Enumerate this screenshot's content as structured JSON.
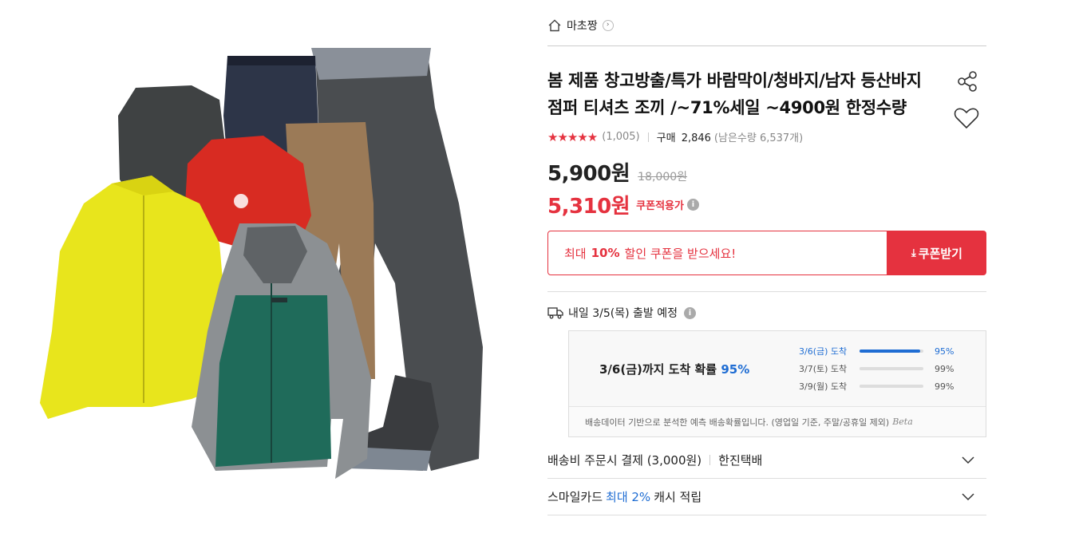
{
  "shop": {
    "name": "마초짱",
    "home_icon": "home-icon",
    "arrow": "›"
  },
  "product": {
    "title": "봄 제품 창고방출/특가 바람막이/청바지/남자 등산바지 점퍼 티셔츠 조끼 /~71%세일 ~4900원 한정수량",
    "stars": "★★★★★",
    "rating": 4.5,
    "review_count": "(1,005)",
    "purchase_label": "구매",
    "purchase_count": "2,846",
    "remaining": "(남은수량 6,537개)"
  },
  "price": {
    "sale": "5,900원",
    "original": "18,000원",
    "coupon_price": "5,310원",
    "coupon_label": "쿠폰적용가",
    "info_icon": "i"
  },
  "coupon": {
    "msg_prefix": "최대",
    "msg_strong": "10%",
    "msg_suffix": "할인 쿠폰을 받으세요!",
    "button_icon": "⤓",
    "button_label": "쿠폰받기"
  },
  "shipping": {
    "depart_text": "내일 3/5(목) 출발 예정",
    "headline_prefix": "3/6(금)까지 도착 확률",
    "headline_pct": "95%",
    "rows": [
      {
        "date": "3/6(금) 도착",
        "pct": "95%",
        "value": 0.95,
        "active": true
      },
      {
        "date": "3/7(토) 도착",
        "pct": "99%",
        "value": 0.99,
        "active": false
      },
      {
        "date": "3/9(월) 도착",
        "pct": "99%",
        "value": 0.99,
        "active": false
      }
    ],
    "note": "배송데이터 기반으로 분석한 예측 배송확률입니다. (영업일 기준, 주말/공휴일 제외)",
    "beta": "Beta"
  },
  "accordion": {
    "fee_label": "배송비 주문시 결제 (3,000원)",
    "courier": "한진택배",
    "card_prefix": "스마일카드",
    "card_highlight": "최대 2%",
    "card_suffix": "캐시 적립"
  },
  "colors": {
    "accent_red": "#e5323f",
    "accent_blue": "#1f6dd3"
  }
}
